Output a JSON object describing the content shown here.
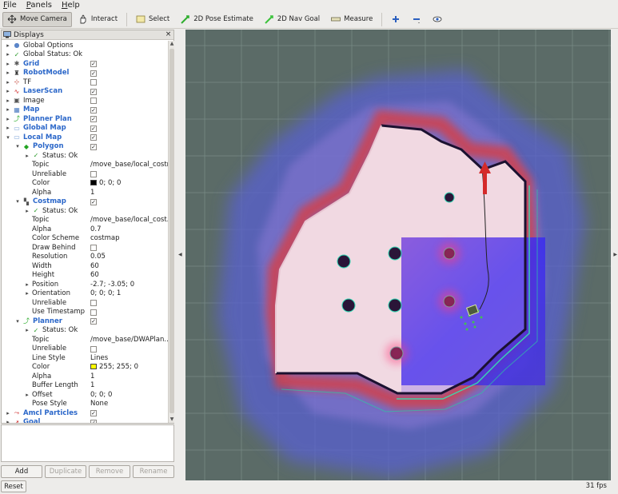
{
  "menu": [
    {
      "label": "File",
      "u": "F",
      "rest": "ile"
    },
    {
      "label": "Panels",
      "u": "P",
      "rest": "anels"
    },
    {
      "label": "Help",
      "u": "H",
      "rest": "elp"
    }
  ],
  "toolbar": {
    "move_camera": "Move Camera",
    "interact": "Interact",
    "select": "Select",
    "pose_estimate": "2D Pose Estimate",
    "nav_goal": "2D Nav Goal",
    "measure": "Measure"
  },
  "displays_panel": {
    "title": "Displays",
    "rows": [
      {
        "indent": 0,
        "arrow": "right",
        "icon": "globe-icon",
        "label": "Global Options",
        "blue": false
      },
      {
        "indent": 0,
        "arrow": "right",
        "icon": "check-icon",
        "label": "Global Status: Ok",
        "blue": false
      },
      {
        "indent": 0,
        "arrow": "right",
        "icon": "grid-icon",
        "label": "Grid",
        "blue": true,
        "checkbox": true
      },
      {
        "indent": 0,
        "arrow": "right",
        "icon": "robot-icon",
        "label": "RobotModel",
        "blue": true,
        "checkbox": true
      },
      {
        "indent": 0,
        "arrow": "right",
        "icon": "tf-icon",
        "label": "TF",
        "blue": false,
        "checkbox": false
      },
      {
        "indent": 0,
        "arrow": "right",
        "icon": "laserscan-icon",
        "label": "LaserScan",
        "blue": true,
        "checkbox": true
      },
      {
        "indent": 0,
        "arrow": "right",
        "icon": "image-icon",
        "label": "Image",
        "blue": false,
        "checkbox": false
      },
      {
        "indent": 0,
        "arrow": "right",
        "icon": "map-icon",
        "label": "Map",
        "blue": true,
        "checkbox": true
      },
      {
        "indent": 0,
        "arrow": "right",
        "icon": "path-icon",
        "label": "Planner Plan",
        "blue": true,
        "checkbox": true
      },
      {
        "indent": 0,
        "arrow": "right",
        "icon": "folder-icon",
        "label": "Global Map",
        "blue": true,
        "checkbox": true
      },
      {
        "indent": 0,
        "arrow": "down",
        "icon": "folder-icon",
        "label": "Local Map",
        "blue": true,
        "checkbox": true
      },
      {
        "indent": 1,
        "arrow": "down",
        "icon": "polygon-icon",
        "label": "Polygon",
        "blue": true,
        "checkbox": true
      },
      {
        "indent": 2,
        "arrow": "right",
        "icon": "check-icon",
        "label": "Status: Ok",
        "blue": false
      },
      {
        "indent": 2,
        "label": "Topic",
        "value": "/move_base/local_costm..."
      },
      {
        "indent": 2,
        "label": "Unreliable",
        "checkbox": false
      },
      {
        "indent": 2,
        "label": "Color",
        "swatch": "#000000",
        "value": "0; 0; 0"
      },
      {
        "indent": 2,
        "label": "Alpha",
        "value": "1"
      },
      {
        "indent": 1,
        "arrow": "down",
        "icon": "costmap-icon",
        "label": "Costmap",
        "blue": true,
        "checkbox": true
      },
      {
        "indent": 2,
        "arrow": "right",
        "icon": "check-icon",
        "label": "Status: Ok",
        "blue": false
      },
      {
        "indent": 2,
        "label": "Topic",
        "value": "/move_base/local_cost..."
      },
      {
        "indent": 2,
        "label": "Alpha",
        "value": "0.7"
      },
      {
        "indent": 2,
        "label": "Color Scheme",
        "value": "costmap"
      },
      {
        "indent": 2,
        "label": "Draw Behind",
        "checkbox": false
      },
      {
        "indent": 2,
        "label": "Resolution",
        "value": "0.05"
      },
      {
        "indent": 2,
        "label": "Width",
        "value": "60"
      },
      {
        "indent": 2,
        "label": "Height",
        "value": "60"
      },
      {
        "indent": 2,
        "arrow": "right",
        "label": "Position",
        "value": "-2.7; -3.05; 0"
      },
      {
        "indent": 2,
        "arrow": "right",
        "label": "Orientation",
        "value": "0; 0; 0; 1"
      },
      {
        "indent": 2,
        "label": "Unreliable",
        "checkbox": false
      },
      {
        "indent": 2,
        "label": "Use Timestamp",
        "checkbox": false
      },
      {
        "indent": 1,
        "arrow": "down",
        "icon": "path-icon",
        "label": "Planner",
        "blue": true,
        "checkbox": true
      },
      {
        "indent": 2,
        "arrow": "right",
        "icon": "check-icon",
        "label": "Status: Ok",
        "blue": false
      },
      {
        "indent": 2,
        "label": "Topic",
        "value": "/move_base/DWAPlan..."
      },
      {
        "indent": 2,
        "label": "Unreliable",
        "checkbox": false
      },
      {
        "indent": 2,
        "label": "Line Style",
        "value": "Lines"
      },
      {
        "indent": 2,
        "label": "Color",
        "swatch": "#ffff00",
        "value": "255; 255; 0"
      },
      {
        "indent": 2,
        "label": "Alpha",
        "value": "1"
      },
      {
        "indent": 2,
        "label": "Buffer Length",
        "value": "1"
      },
      {
        "indent": 2,
        "arrow": "right",
        "label": "Offset",
        "value": "0; 0; 0"
      },
      {
        "indent": 2,
        "label": "Pose Style",
        "value": "None"
      },
      {
        "indent": 0,
        "arrow": "right",
        "icon": "particles-icon",
        "label": "Amcl Particles",
        "blue": true,
        "checkbox": true
      },
      {
        "indent": 0,
        "arrow": "right",
        "icon": "goal-icon",
        "label": "Goal",
        "blue": true,
        "checkbox": true
      }
    ]
  },
  "buttons": {
    "add": "Add",
    "duplicate": "Duplicate",
    "remove": "Remove",
    "rename": "Rename",
    "reset": "Reset"
  },
  "status": {
    "fps": "31 fps"
  },
  "colors": {
    "link_blue": "#2b67c9",
    "viewport_bg": "#5b6b67",
    "costmap_blue": "#4b55d8",
    "free_space": "#f0d8e0"
  }
}
